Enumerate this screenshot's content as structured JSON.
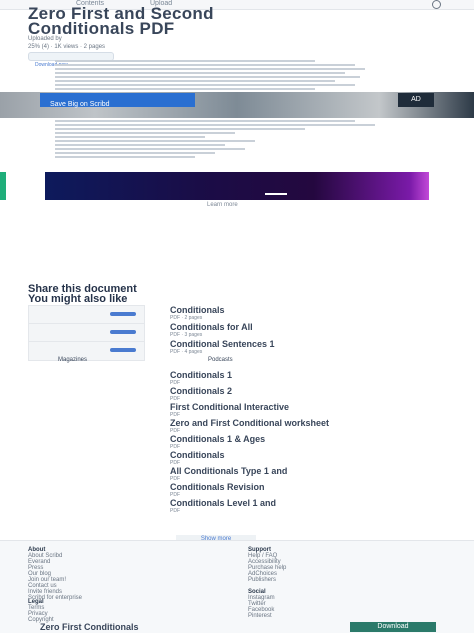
{
  "header": {
    "nav_a": "Contents",
    "nav_b": "Upload",
    "title_line1": "Zero First and Second",
    "title_line2": "Conditionals PDF",
    "uploaded_by": "Uploaded by",
    "meta": "25% (4) · 1K views · 2 pages",
    "download_tag": "Download now"
  },
  "banner": {
    "left_text": "Save Big on Scribd",
    "right_text": "AD"
  },
  "video": {
    "cap": "Learn more"
  },
  "share": {
    "title": "Share this document",
    "also_like": "You might also like"
  },
  "related": [
    {
      "title": "Conditionals",
      "meta": "PDF · 2 pages"
    },
    {
      "title": "Conditionals for All",
      "meta": "PDF · 3 pages"
    },
    {
      "title": "Conditional Sentences 1",
      "meta": "PDF · 4 pages"
    },
    {
      "title": "Magazines",
      "meta": "Podcasts"
    },
    {
      "title": "Conditionals 1",
      "meta": "PDF"
    },
    {
      "title": "Conditionals 2",
      "meta": "PDF"
    },
    {
      "title": "First Conditional Interactive",
      "meta": "PDF"
    },
    {
      "title": "Zero and First Conditional worksheet",
      "meta": "PDF"
    },
    {
      "title": "Conditionals 1 & Ages",
      "meta": "PDF"
    },
    {
      "title": "Conditionals",
      "meta": "PDF"
    },
    {
      "title": "All Conditionals Type 1 and",
      "meta": "PDF"
    },
    {
      "title": "Conditionals Revision",
      "meta": "PDF"
    },
    {
      "title": "Conditionals Level 1 and",
      "meta": "PDF"
    }
  ],
  "show_more": "Show more",
  "footer": {
    "col1_head": "About",
    "col1_links": [
      "About Scribd",
      "Everand",
      "Press",
      "Our blog",
      "Join our team!",
      "Contact us",
      "Invite friends",
      "Scribd for enterprise"
    ],
    "col2_head": "Support",
    "col2_links": [
      "Help / FAQ",
      "Accessibility",
      "Purchase help",
      "AdChoices",
      "Publishers"
    ],
    "social_head": "Social",
    "social_links": [
      "Instagram",
      "Twitter",
      "Facebook",
      "Pinterest"
    ],
    "legal_head": "Legal",
    "legal_links": [
      "Terms",
      "Privacy",
      "Copyright",
      "Cookie Preferences",
      "Do not sell or share my personal information"
    ],
    "bottom_links": [
      "Documents",
      "Language",
      "English"
    ]
  },
  "bottom_bar": {
    "subtitle": "Zero First Conditionals",
    "download": "Download"
  }
}
